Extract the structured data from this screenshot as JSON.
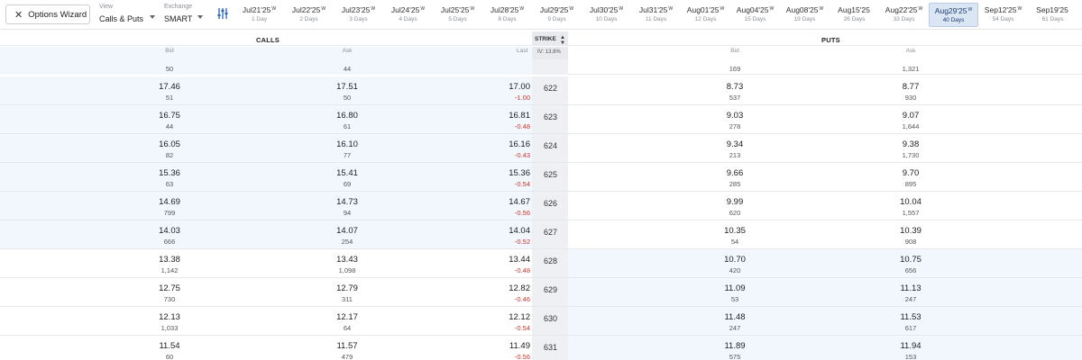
{
  "toolbar": {
    "wizard_label": "Options Wizard",
    "view_label": "View",
    "view_value": "Calls & Puts",
    "exchange_label": "Exchange",
    "exchange_value": "SMART"
  },
  "expirations": [
    {
      "date": "Jul21'25",
      "weekly": "W",
      "days": "1 Day"
    },
    {
      "date": "Jul22'25",
      "weekly": "W",
      "days": "2 Days"
    },
    {
      "date": "Jul23'25",
      "weekly": "W",
      "days": "3 Days"
    },
    {
      "date": "Jul24'25",
      "weekly": "W",
      "days": "4 Days"
    },
    {
      "date": "Jul25'25",
      "weekly": "W",
      "days": "5 Days"
    },
    {
      "date": "Jul28'25",
      "weekly": "W",
      "days": "8 Days"
    },
    {
      "date": "Jul29'25",
      "weekly": "W",
      "days": "9 Days"
    },
    {
      "date": "Jul30'25",
      "weekly": "W",
      "days": "10 Days"
    },
    {
      "date": "Jul31'25",
      "weekly": "W",
      "days": "11 Days"
    },
    {
      "date": "Aug01'25",
      "weekly": "W",
      "days": "12 Days"
    },
    {
      "date": "Aug04'25",
      "weekly": "W",
      "days": "15 Days"
    },
    {
      "date": "Aug08'25",
      "weekly": "W",
      "days": "19 Days"
    },
    {
      "date": "Aug15'25",
      "weekly": "",
      "days": "26 Days"
    },
    {
      "date": "Aug22'25",
      "weekly": "W",
      "days": "33 Days"
    },
    {
      "date": "Aug29'25",
      "weekly": "W",
      "days": "40 Days",
      "active": true
    },
    {
      "date": "Sep12'25",
      "weekly": "W",
      "days": "54 Days"
    },
    {
      "date": "Sep19'25",
      "weekly": "",
      "days": "61 Days"
    }
  ],
  "headers": {
    "calls": "CALLS",
    "puts": "PUTS",
    "strike": "STRIKE",
    "bid": "Bid",
    "ask": "Ask",
    "last": "Last",
    "iv": "IV: 13.8%"
  },
  "partial_row": {
    "call_bid_size": "50",
    "call_ask_size": "44",
    "put_bid_size": "169",
    "put_ask_size": "1,321"
  },
  "rows": [
    {
      "strike": "622",
      "call_bid": "17.46",
      "call_bid_size": "51",
      "call_ask": "17.51",
      "call_ask_size": "50",
      "call_last": "17.00",
      "call_chg": "-1.00",
      "put_bid": "8.73",
      "put_bid_size": "537",
      "put_ask": "8.77",
      "put_ask_size": "930"
    },
    {
      "strike": "623",
      "call_bid": "16.75",
      "call_bid_size": "44",
      "call_ask": "16.80",
      "call_ask_size": "61",
      "call_last": "16.81",
      "call_chg": "-0.48",
      "put_bid": "9.03",
      "put_bid_size": "278",
      "put_ask": "9.07",
      "put_ask_size": "1,644"
    },
    {
      "strike": "624",
      "call_bid": "16.05",
      "call_bid_size": "82",
      "call_ask": "16.10",
      "call_ask_size": "77",
      "call_last": "16.16",
      "call_chg": "-0.43",
      "put_bid": "9.34",
      "put_bid_size": "213",
      "put_ask": "9.38",
      "put_ask_size": "1,730"
    },
    {
      "strike": "625",
      "call_bid": "15.36",
      "call_bid_size": "63",
      "call_ask": "15.41",
      "call_ask_size": "69",
      "call_last": "15.36",
      "call_chg": "-0.54",
      "put_bid": "9.66",
      "put_bid_size": "285",
      "put_ask": "9.70",
      "put_ask_size": "895"
    },
    {
      "strike": "626",
      "call_bid": "14.69",
      "call_bid_size": "799",
      "call_ask": "14.73",
      "call_ask_size": "94",
      "call_last": "14.67",
      "call_chg": "-0.56",
      "put_bid": "9.99",
      "put_bid_size": "620",
      "put_ask": "10.04",
      "put_ask_size": "1,557"
    },
    {
      "strike": "627",
      "call_bid": "14.03",
      "call_bid_size": "666",
      "call_ask": "14.07",
      "call_ask_size": "254",
      "call_last": "14.04",
      "call_chg": "-0.52",
      "put_bid": "10.35",
      "put_bid_size": "54",
      "put_ask": "10.39",
      "put_ask_size": "908"
    },
    {
      "strike": "628",
      "call_bid": "13.38",
      "call_bid_size": "1,142",
      "call_ask": "13.43",
      "call_ask_size": "1,098",
      "call_last": "13.44",
      "call_chg": "-0.48",
      "put_bid": "10.70",
      "put_bid_size": "420",
      "put_ask": "10.75",
      "put_ask_size": "656"
    },
    {
      "strike": "629",
      "call_bid": "12.75",
      "call_bid_size": "730",
      "call_ask": "12.79",
      "call_ask_size": "311",
      "call_last": "12.82",
      "call_chg": "-0.46",
      "put_bid": "11.09",
      "put_bid_size": "53",
      "put_ask": "11.13",
      "put_ask_size": "247"
    },
    {
      "strike": "630",
      "call_bid": "12.13",
      "call_bid_size": "1,033",
      "call_ask": "12.17",
      "call_ask_size": "64",
      "call_last": "12.12",
      "call_chg": "-0.54",
      "put_bid": "11.48",
      "put_bid_size": "247",
      "put_ask": "11.53",
      "put_ask_size": "617"
    },
    {
      "strike": "631",
      "call_bid": "11.54",
      "call_bid_size": "60",
      "call_ask": "11.57",
      "call_ask_size": "479",
      "call_last": "11.49",
      "call_chg": "-0.56",
      "put_bid": "11.89",
      "put_bid_size": "575",
      "put_ask": "11.94",
      "put_ask_size": "153"
    }
  ],
  "colors": {
    "negative": "#d0342c",
    "positive": "#1f9d55",
    "itm_shade": "#f1f7fc",
    "active_tab": "#dbe6f5"
  }
}
